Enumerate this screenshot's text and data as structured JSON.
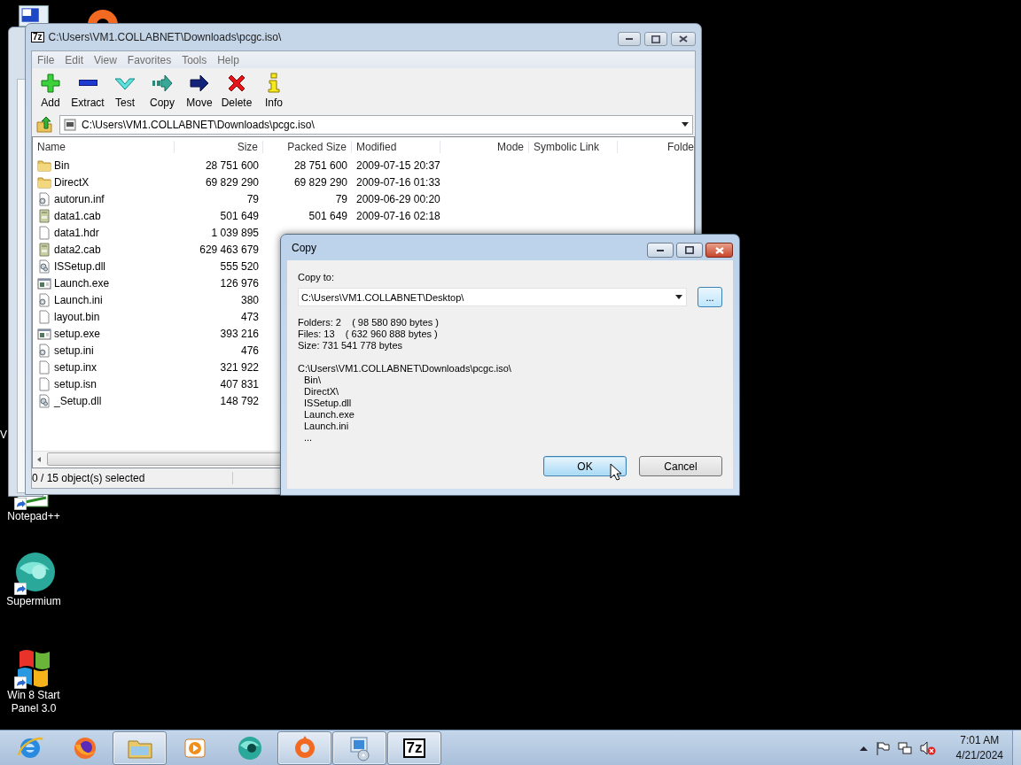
{
  "desktop_icons": [
    {
      "kind": "computer"
    },
    {
      "kind": "origin"
    },
    {
      "kind": "covered",
      "label": "V"
    },
    {
      "kind": "notepad",
      "label": "Notepad++"
    },
    {
      "kind": "supermium",
      "label": "Supermium"
    },
    {
      "kind": "windows",
      "label": "Win 8 Start Panel 3.0"
    }
  ],
  "main_window": {
    "logo": "7z",
    "title": "C:\\Users\\VM1.COLLABNET\\Downloads\\pcgc.iso\\",
    "menu": [
      "File",
      "Edit",
      "View",
      "Favorites",
      "Tools",
      "Help"
    ],
    "toolbar": [
      {
        "kind": "add",
        "label": "Add"
      },
      {
        "kind": "extract",
        "label": "Extract"
      },
      {
        "kind": "test",
        "label": "Test"
      },
      {
        "kind": "copy",
        "label": "Copy"
      },
      {
        "kind": "move",
        "label": "Move"
      },
      {
        "kind": "delete",
        "label": "Delete"
      },
      {
        "kind": "info",
        "label": "Info"
      }
    ],
    "address": "C:\\Users\\VM1.COLLABNET\\Downloads\\pcgc.iso\\",
    "columns": [
      "Name",
      "Size",
      "Packed Size",
      "Modified",
      "Mode",
      "Symbolic Link",
      "Folde"
    ],
    "rows": [
      {
        "kind": "folder",
        "name": "Bin",
        "size": "28 751 600",
        "packed": "28 751 600",
        "modified": "2009-07-15 20:37"
      },
      {
        "kind": "folder",
        "name": "DirectX",
        "size": "69 829 290",
        "packed": "69 829 290",
        "modified": "2009-07-16 01:33"
      },
      {
        "kind": "config",
        "name": "autorun.inf",
        "size": "79",
        "packed": "79",
        "modified": "2009-06-29 00:20"
      },
      {
        "kind": "cab",
        "name": "data1.cab",
        "size": "501 649",
        "packed": "501 649",
        "modified": "2009-07-16 02:18"
      },
      {
        "kind": "blank",
        "name": "data1.hdr",
        "size": "1 039 895"
      },
      {
        "kind": "cab",
        "name": "data2.cab",
        "size": "629 463 679"
      },
      {
        "kind": "dll",
        "name": "ISSetup.dll",
        "size": "555 520"
      },
      {
        "kind": "exe",
        "name": "Launch.exe",
        "size": "126 976"
      },
      {
        "kind": "config",
        "name": "Launch.ini",
        "size": "380"
      },
      {
        "kind": "blank",
        "name": "layout.bin",
        "size": "473"
      },
      {
        "kind": "exe",
        "name": "setup.exe",
        "size": "393 216"
      },
      {
        "kind": "config",
        "name": "setup.ini",
        "size": "476"
      },
      {
        "kind": "blank",
        "name": "setup.inx",
        "size": "321 922"
      },
      {
        "kind": "blank",
        "name": "setup.isn",
        "size": "407 831"
      },
      {
        "kind": "dll",
        "name": "_Setup.dll",
        "size": "148 792"
      }
    ],
    "status": "0 / 15 object(s) selected"
  },
  "dialog": {
    "title": "Copy",
    "copy_to_label": "Copy to:",
    "destination": "C:\\Users\\VM1.COLLABNET\\Desktop\\",
    "browse": "...",
    "info": [
      "Folders: 2    ( 98 580 890 bytes )",
      "Files: 13    ( 632 960 888 bytes )",
      "Size: 731 541 778 bytes"
    ],
    "source": "C:\\Users\\VM1.COLLABNET\\Downloads\\pcgc.iso\\",
    "items": [
      "Bin\\",
      "DirectX\\",
      "ISSetup.dll",
      "Launch.exe",
      "Launch.ini",
      "..."
    ],
    "buttons": [
      {
        "label": "OK",
        "default": true
      },
      {
        "label": "Cancel",
        "default": false
      }
    ]
  },
  "taskbar": {
    "apps": [
      {
        "kind": "ie",
        "open": false
      },
      {
        "kind": "firefox",
        "open": false
      },
      {
        "kind": "explorer",
        "open": true
      },
      {
        "kind": "media",
        "open": false
      },
      {
        "kind": "supermium",
        "open": false
      },
      {
        "kind": "origin",
        "open": true
      },
      {
        "kind": "pc",
        "open": true
      },
      {
        "kind": "sevenzip",
        "open": true,
        "logo": "7z"
      }
    ],
    "time": "7:01 AM",
    "date": "4/21/2024"
  }
}
